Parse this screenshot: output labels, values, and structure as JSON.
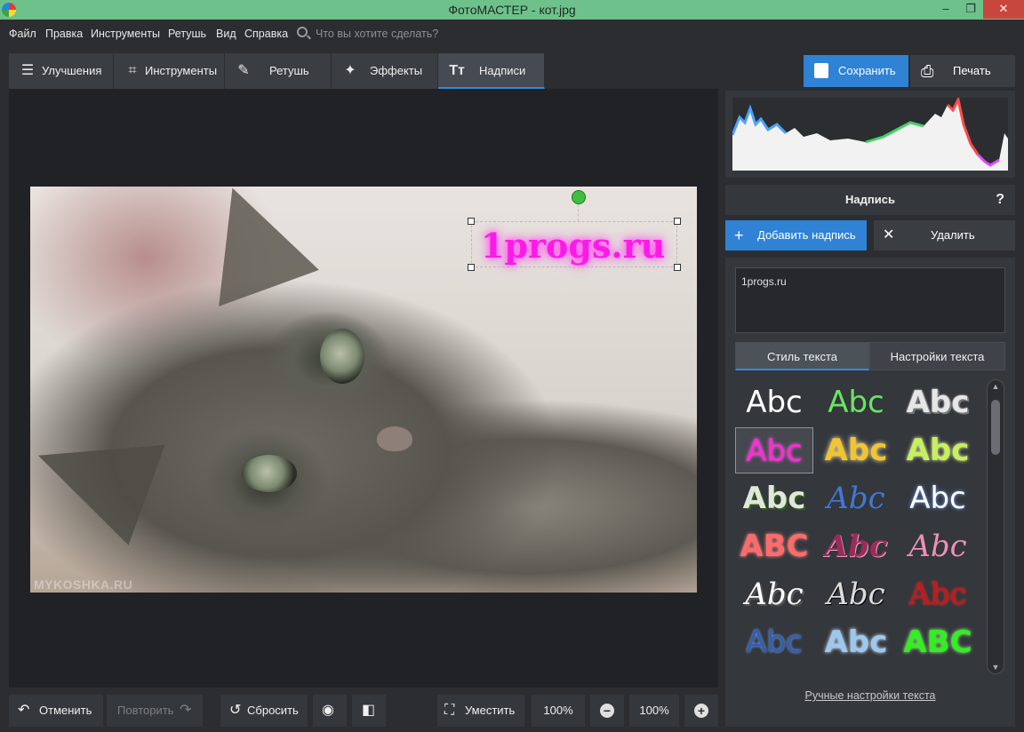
{
  "window": {
    "title": "ФотоМАСТЕР - кот.jpg",
    "controls": [
      "‒",
      "❐",
      "✕"
    ]
  },
  "menu": {
    "items": [
      "Файл",
      "Правка",
      "Инструменты",
      "Ретушь",
      "Вид",
      "Справка"
    ],
    "search_placeholder": "Что вы хотите сделать?"
  },
  "tabs": [
    {
      "label": "Улучшения",
      "icon": "sliders-icon"
    },
    {
      "label": "Инструменты",
      "icon": "crop-icon"
    },
    {
      "label": "Ретушь",
      "icon": "brush-icon"
    },
    {
      "label": "Эффекты",
      "icon": "magic-wand-icon"
    },
    {
      "label": "Надписи",
      "icon": "text-icon",
      "active": true
    }
  ],
  "top_buttons": {
    "save": "Сохранить",
    "print": "Печать"
  },
  "canvas": {
    "overlay_text": "1progs.ru",
    "watermark": "MYKOSHKA.RU"
  },
  "panel": {
    "section_title": "Надпись",
    "help": "?",
    "add_label": "Добавить надпись",
    "delete_label": "Удалить",
    "text_value": "1progs.ru",
    "subtabs": [
      "Стиль текста",
      "Настройки текста"
    ],
    "manual_settings_link": "Ручные настройки текста",
    "styles": [
      {
        "text": "Abc",
        "color": "#ffffff"
      },
      {
        "text": "Abc",
        "color": "#6fe06a"
      },
      {
        "text": "Abc",
        "color": "#e6e6e6"
      },
      {
        "text": "Abc",
        "color": "#ff2bd6",
        "selected": true
      },
      {
        "text": "Abc",
        "color": "#f4c430"
      },
      {
        "text": "Abc",
        "color": "#c6f05e"
      },
      {
        "text": "Abc",
        "color": "#dfe8d8"
      },
      {
        "text": "Abc",
        "color": "#3f78d8"
      },
      {
        "text": "Abc",
        "color": "#ffffff"
      },
      {
        "text": "ABC",
        "color": "#ff6b6b"
      },
      {
        "text": "Abc",
        "color": "#9b2b5a"
      },
      {
        "text": "Abc",
        "color": "#ee8fb8"
      },
      {
        "text": "Abc",
        "color": "#ffffff"
      },
      {
        "text": "Abc",
        "color": "#dcdcdc"
      },
      {
        "text": "Abc",
        "color": "#c21a1a"
      },
      {
        "text": "Abc",
        "color": "#2f5fb0"
      },
      {
        "text": "Abc",
        "color": "#9cc8f0"
      },
      {
        "text": "ABC",
        "color": "#33ee22"
      }
    ]
  },
  "bottom": {
    "undo": "Отменить",
    "redo": "Повторить",
    "reset": "Сбросить",
    "fit": "Уместить",
    "zoom_a": "100%",
    "zoom_b": "100%"
  },
  "histogram": {
    "colors": [
      "#4aa3ff",
      "#49d06a",
      "#ff4a4a",
      "#d94aff",
      "#ffffff"
    ]
  }
}
